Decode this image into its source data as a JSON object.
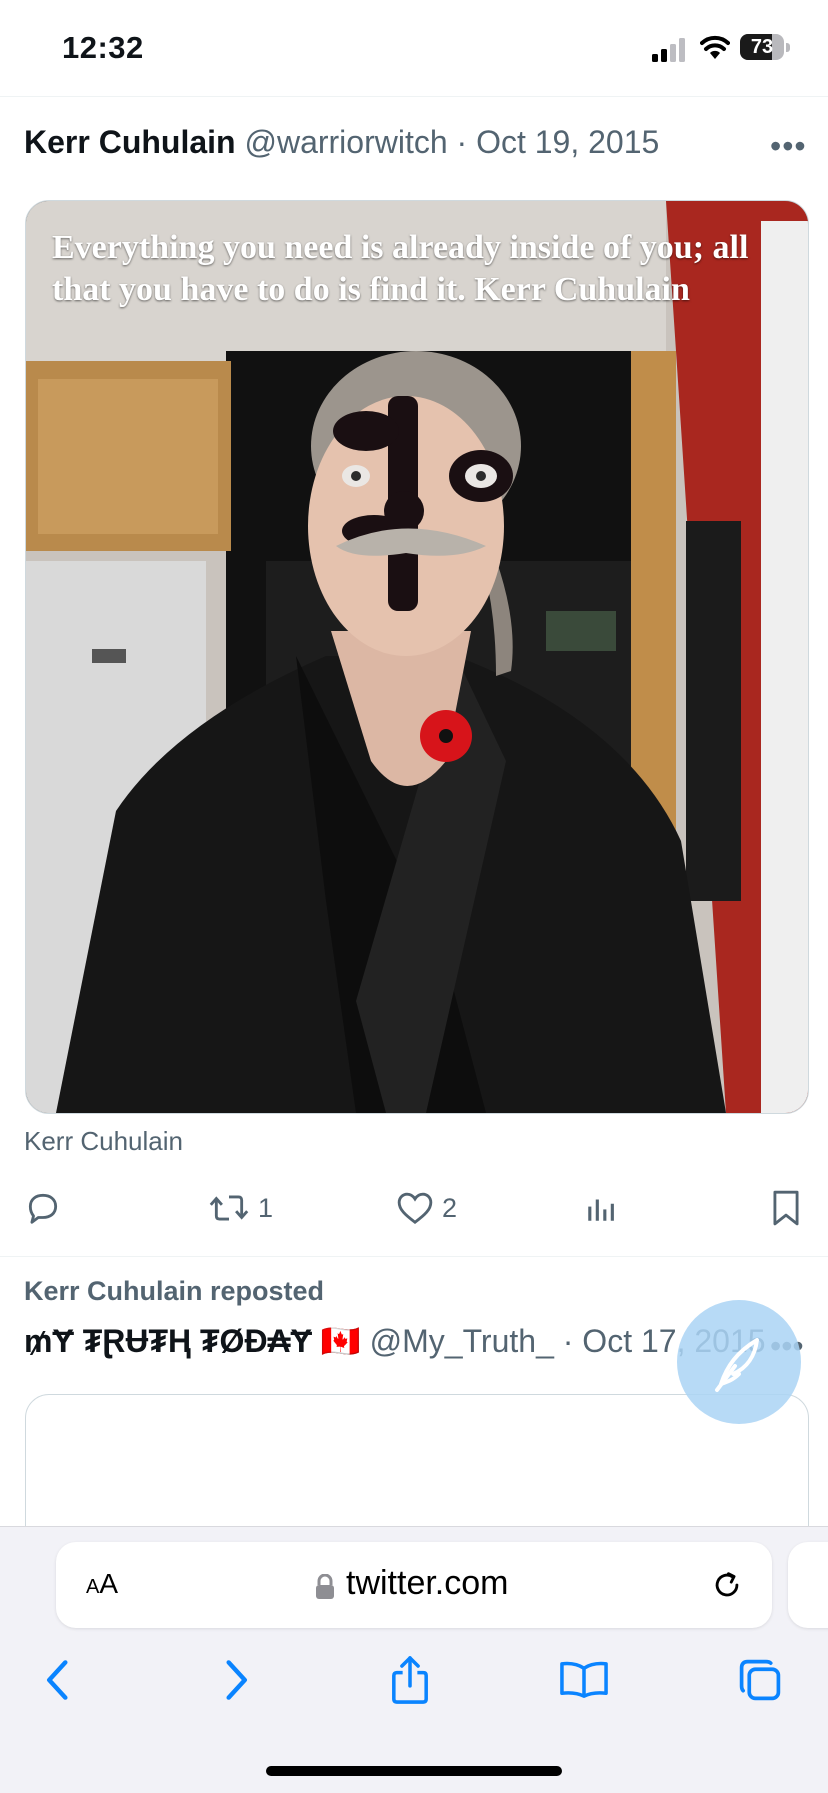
{
  "status_bar": {
    "time": "12:32",
    "battery": "73",
    "battery_level": 0.73
  },
  "tweet": {
    "author_name": "Kerr Cuhulain",
    "handle": "@warriorwitch",
    "separator": "·",
    "date": "Oct 19, 2015",
    "more": "•••",
    "media_caption": "Everything you need is already inside of you; all that you have to do is find it. Kerr Cuhulain",
    "media_credit": "Kerr Cuhulain",
    "actions": {
      "reply_count": "",
      "repost_count": "1",
      "like_count": "2"
    }
  },
  "repost": {
    "label": "Kerr Cuhulain reposted",
    "author_name": "₥Ɏ ₮ⱤɄ₮Ⱨ ₮ØĐ₳Ɏ",
    "flag": "🇨🇦",
    "handle": "@My_Truth_",
    "separator": "·",
    "date": "Oct 17, 2015",
    "more": "•••"
  },
  "safari": {
    "text_size_label_small": "A",
    "text_size_label_large": "A",
    "url": "twitter.com"
  },
  "colors": {
    "accent": "#1d9bf0",
    "muted": "#536471",
    "safari_blue": "#0a84ff"
  }
}
